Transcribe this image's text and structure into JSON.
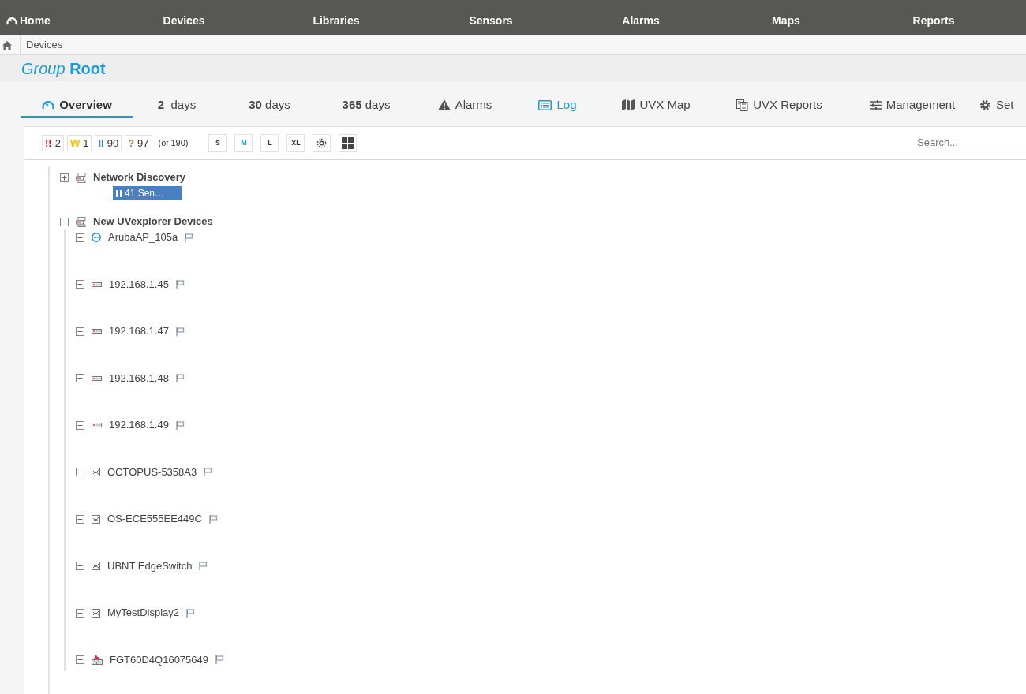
{
  "nav": [
    "Home",
    "Devices",
    "Libraries",
    "Sensors",
    "Alarms",
    "Maps",
    "Reports"
  ],
  "breadcrumb": [
    "Devices"
  ],
  "title": "*Group* **Root**",
  "tabs": [
    {
      "label": "Overview",
      "kind": "overview",
      "selected": true,
      "hover": false
    },
    {
      "label": "**2**  days",
      "kind": "days",
      "selected": false,
      "hover": false
    },
    {
      "label": "**30** days",
      "kind": "days",
      "selected": false,
      "hover": false
    },
    {
      "label": "**365** days",
      "kind": "days",
      "selected": false,
      "hover": false
    },
    {
      "label": "Alarms",
      "kind": "alarms",
      "selected": false,
      "hover": false
    },
    {
      "label": "Log",
      "kind": "log",
      "selected": false,
      "hover": true
    },
    {
      "label": "UVX Map",
      "kind": "map",
      "selected": false,
      "hover": false
    },
    {
      "label": "UVX Reports",
      "kind": "reports",
      "selected": false,
      "hover": false
    },
    {
      "label": "Management",
      "kind": "management",
      "selected": false,
      "hover": false
    },
    {
      "label": "Set",
      "kind": "settings",
      "selected": false,
      "hover": false
    }
  ],
  "status_counts": [
    {
      "kind": "error",
      "symbol": "!!",
      "count": "2"
    },
    {
      "kind": "warning",
      "symbol": "W",
      "count": "1"
    },
    {
      "kind": "paused",
      "symbol": "II",
      "count": "90"
    },
    {
      "kind": "unknown",
      "symbol": "?",
      "count": "97"
    }
  ],
  "total": "(of 190)",
  "sizes": [
    {
      "label": "S",
      "selected": false
    },
    {
      "label": "M",
      "selected": true
    },
    {
      "label": "L",
      "selected": false
    },
    {
      "label": "XL",
      "selected": false
    }
  ],
  "search": {
    "placeholder": "Search..."
  },
  "tree": [
    {
      "name": "Network Discovery",
      "expanded": false,
      "badge": "41 Sen…"
    },
    {
      "name": "New UVexplorer Devices",
      "expanded": true,
      "children": [
        {
          "name": "ArubaAP_105a",
          "kind": "access-point"
        },
        {
          "name": "192.168.1.45",
          "kind": "server"
        },
        {
          "name": "192.168.1.47",
          "kind": "server"
        },
        {
          "name": "192.168.1.48",
          "kind": "server"
        },
        {
          "name": "192.168.1.49",
          "kind": "server"
        },
        {
          "name": "OCTOPUS-5358A3",
          "kind": "generic"
        },
        {
          "name": "OS-ECE555EE449C",
          "kind": "generic"
        },
        {
          "name": "UBNT EdgeSwitch",
          "kind": "generic"
        },
        {
          "name": "MyTestDisplay2",
          "kind": "generic"
        },
        {
          "name": "FGT60D4Q16075649",
          "kind": "firewall"
        }
      ]
    }
  ]
}
